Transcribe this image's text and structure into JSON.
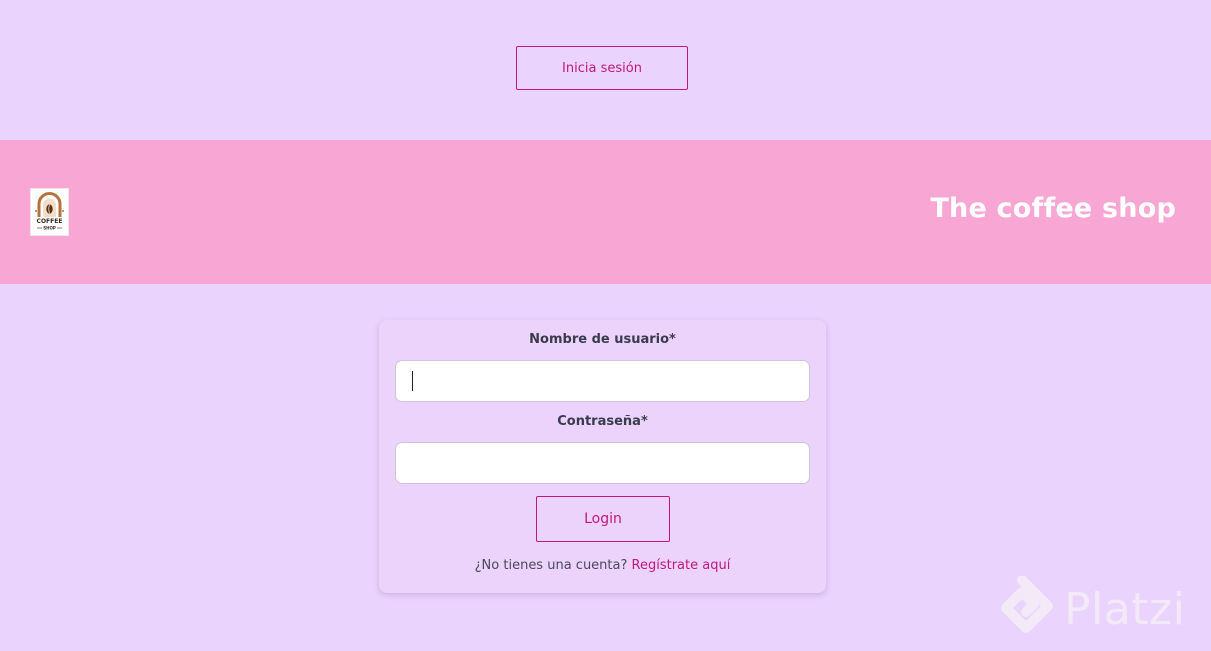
{
  "top_bar": {
    "login_button_label": "Inicia sesión"
  },
  "header": {
    "logo_icon": "coffee-shop-logo",
    "logo_text_top": "COFFEE",
    "logo_text_bottom": "SHOP",
    "title": "The coffee shop"
  },
  "login_form": {
    "username_label": "Nombre de usuario*",
    "username_value": "",
    "password_label": "Contraseña*",
    "password_value": "",
    "submit_label": "Login",
    "signup_prompt": "¿No tienes una cuenta?",
    "signup_link": "Regístrate aquí"
  },
  "watermark": {
    "text": "Platzi"
  },
  "colors": {
    "page_background": "#ead3fd",
    "header_background": "#f8a7d5",
    "accent": "#c1197a",
    "header_text": "#ffffff"
  }
}
